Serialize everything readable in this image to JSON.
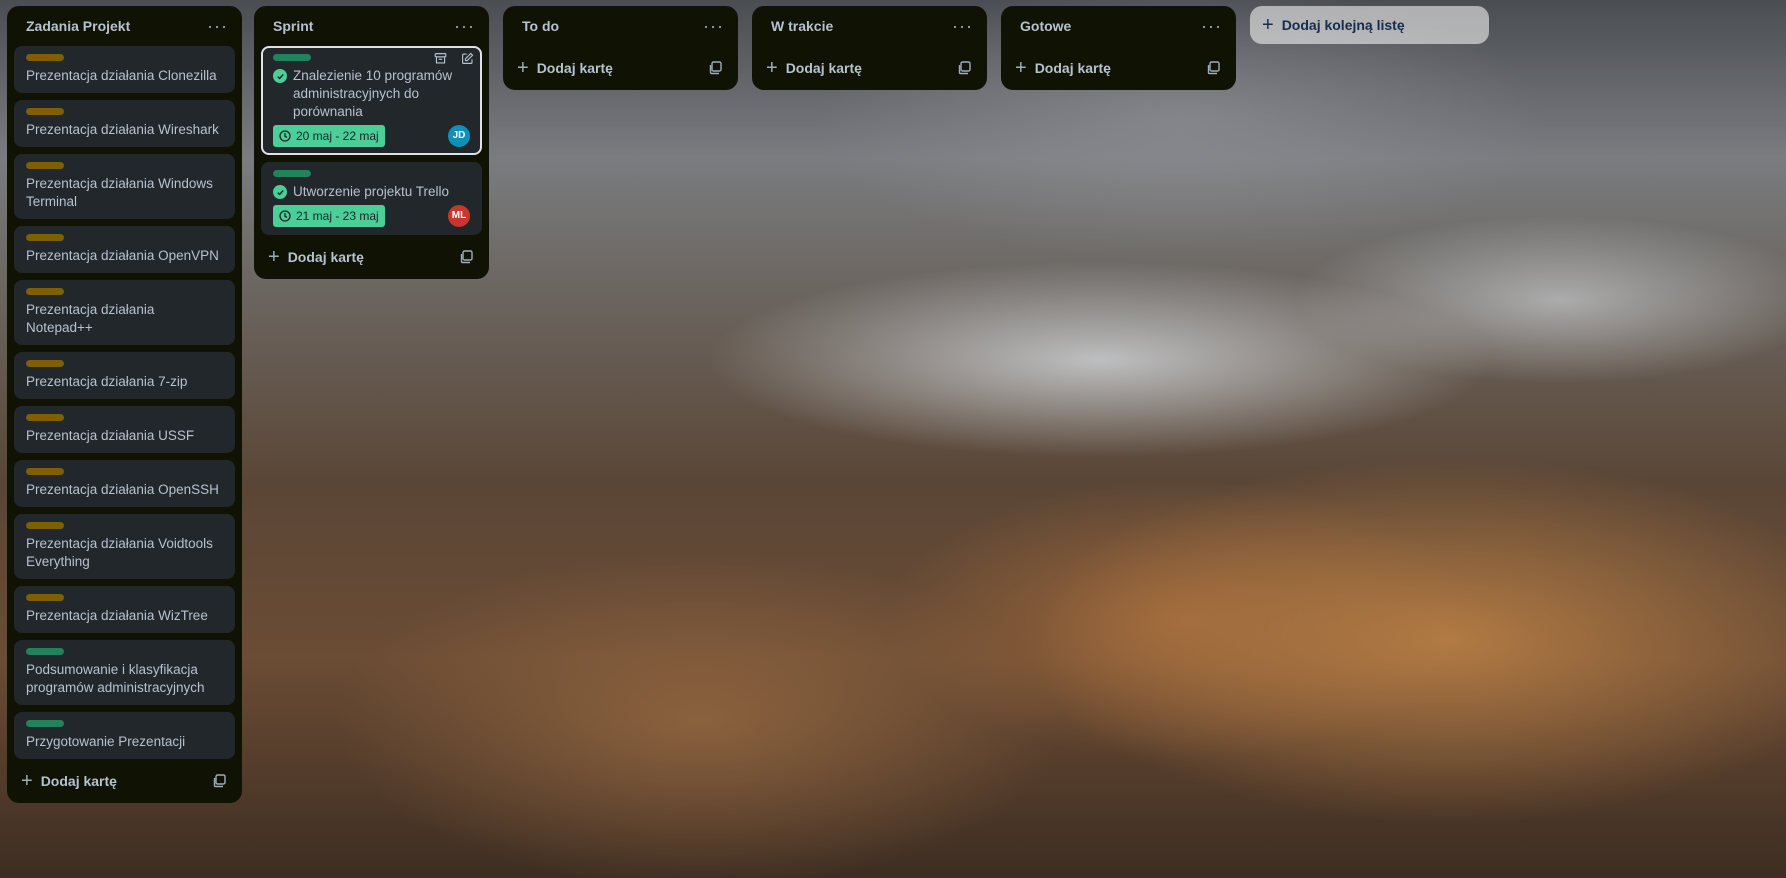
{
  "colors": {
    "list_bg": "#101204",
    "card_bg": "#22272b",
    "label_yellow": "#7f5f01",
    "label_green": "#1f845a",
    "date_badge": "#4bce97",
    "avatar_jd": "#0c91b8",
    "avatar_ml": "#c9372c"
  },
  "add_card_label": "Dodaj kartę",
  "add_list_label": "Dodaj kolejną listę",
  "lists": [
    {
      "title": "Zadania Projekt",
      "cards": [
        {
          "label_color": "yellow",
          "title": "Prezentacja działania Clonezilla"
        },
        {
          "label_color": "yellow",
          "title": "Prezentacja działania Wireshark"
        },
        {
          "label_color": "yellow",
          "title": "Prezentacja działania Windows Terminal"
        },
        {
          "label_color": "yellow",
          "title": "Prezentacja działania OpenVPN"
        },
        {
          "label_color": "yellow",
          "title": "Prezentacja działania Notepad++"
        },
        {
          "label_color": "yellow",
          "title": "Prezentacja działania 7-zip"
        },
        {
          "label_color": "yellow",
          "title": "Prezentacja działania USSF"
        },
        {
          "label_color": "yellow",
          "title": "Prezentacja działania OpenSSH"
        },
        {
          "label_color": "yellow",
          "title": "Prezentacja działania Voidtools Everything"
        },
        {
          "label_color": "yellow",
          "title": "Prezentacja działania WizTree"
        },
        {
          "label_color": "green",
          "title": "Podsumowanie i klasyfikacja programów administracyjnych"
        },
        {
          "label_color": "green",
          "title": "Przygotowanie Prezentacji"
        }
      ]
    },
    {
      "title": "Sprint",
      "cards": [
        {
          "label_color": "green",
          "title": "Znalezienie 10 programów administracyjnych do porównania",
          "date": "20 maj - 22 maj",
          "member": "JD",
          "completed": true
        },
        {
          "label_color": "green",
          "title": "Utworzenie projektu Trello",
          "date": "21 maj - 23 maj",
          "member": "ML",
          "completed": true
        }
      ]
    },
    {
      "title": "To do",
      "cards": []
    },
    {
      "title": "W trakcie",
      "cards": []
    },
    {
      "title": "Gotowe",
      "cards": []
    }
  ]
}
